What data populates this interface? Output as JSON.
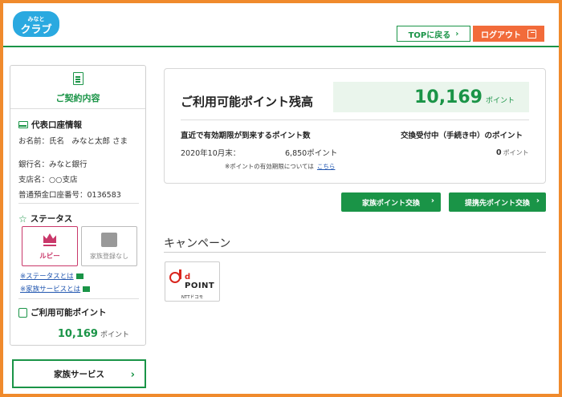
{
  "header": {
    "logo_small": "みなと",
    "logo_large": "クラブ",
    "top_button": "TOPに戻る",
    "logout_button": "ログアウト",
    "chevron": "›"
  },
  "sidebar": {
    "contract_title": "ご契約内容",
    "representative_title": "代表口座情報",
    "name_line": "お名前：氏名　みなと太郎 さま",
    "bank_line": "銀行名：みなと銀行",
    "branch_line": "支店名：○○支店",
    "account_line": "普通預金口座番号：0136583",
    "status_title": "ステータス",
    "status_ruby": "ルビー",
    "status_family": "家族登録なし",
    "link_status": "※ステータスとは",
    "link_family": "※家族サービスとは",
    "points_title": "ご利用可能ポイント",
    "points_value": "10,169",
    "points_unit": "ポイント",
    "star": "☆",
    "family_service_button": "家族サービス",
    "chevron": "›"
  },
  "card": {
    "title": "ご利用可能ポイント残高",
    "balance": "10,169",
    "balance_unit": "ポイント",
    "expire_label": "直近で有効期限が到来するポイント数",
    "expire_date": "2020年10月末：",
    "expire_points": "6,850ポイント",
    "expire_note": "※ポイントの有効期限については",
    "expire_link": "こちら",
    "exchange_label": "交換受付中（手続き中）のポイント",
    "exchange_value": "0",
    "exchange_unit": "ポイント"
  },
  "actions": {
    "family_exchange": "家族ポイント交換",
    "partner_exchange": "提携先ポイント交換",
    "chevron": "›"
  },
  "campaign": {
    "title": "キャンペーン",
    "dpoint_label": "POINT",
    "dpoint_letter": "d",
    "dpoint_company": "NTTドコモ"
  },
  "colors": {
    "brand_green": "#1a9447",
    "frame_orange": "#f08a2c",
    "logout_orange": "#f26b3a",
    "ruby": "#c9386a"
  }
}
